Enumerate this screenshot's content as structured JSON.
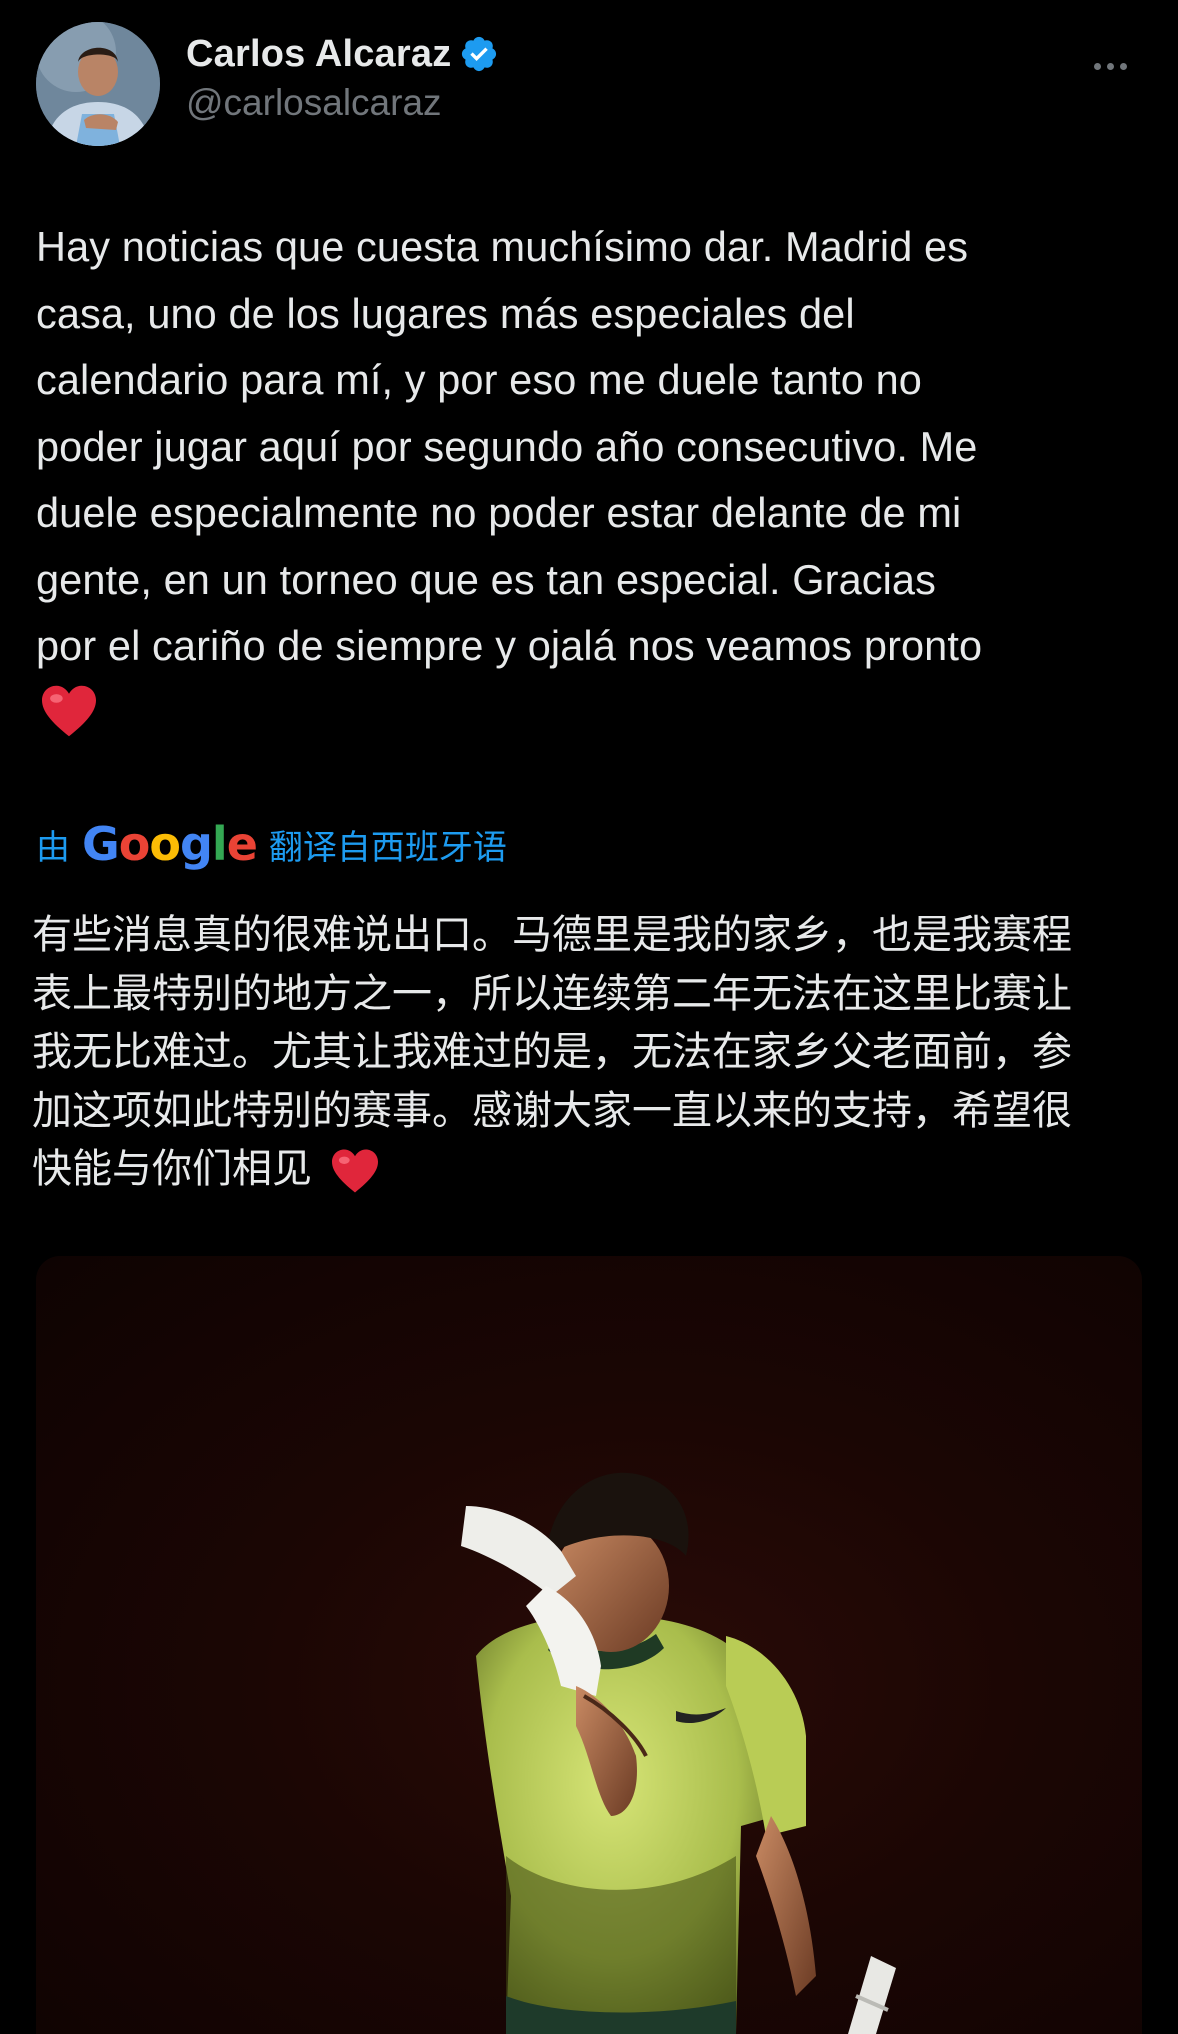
{
  "author": {
    "display_name": "Carlos Alcaraz",
    "handle": "@carlosalcaraz",
    "verified": true,
    "avatar_icon": "avatar-photo"
  },
  "tweet": {
    "text": "Hay noticias que cuesta muchísimo dar. Madrid es\ncasa, uno de los lugares más especiales del\ncalendario para mí, y por eso me duele tanto no\npoder jugar aquí por segundo año consecutivo. Me\nduele especialmente no poder estar delante de mi\ngente, en un torneo que es tan especial. Gracias\npor el cariño de siempre y ojalá nos veamos pronto",
    "emoji": "red-heart"
  },
  "translation": {
    "prefix": "由",
    "provider": "Google",
    "suffix": "翻译自西班牙语",
    "text": "有些消息真的很难说出口。马德里是我的家乡，也是我赛程\n表上最特别的地方之一，所以连续第二年无法在这里比赛让\n我无比难过。尤其让我难过的是，无法在家乡父老面前，参\n加这项如此特别的赛事。感谢大家一直以来的支持，希望很\n快能与你们相见"
  },
  "media": {
    "type": "photo",
    "icon": "tennis-player-photo"
  },
  "colors": {
    "background": "#000000",
    "text": "#e7e9ea",
    "secondary": "#71767b",
    "accent": "#1d9bf0",
    "verified": "#1d9bf0"
  }
}
